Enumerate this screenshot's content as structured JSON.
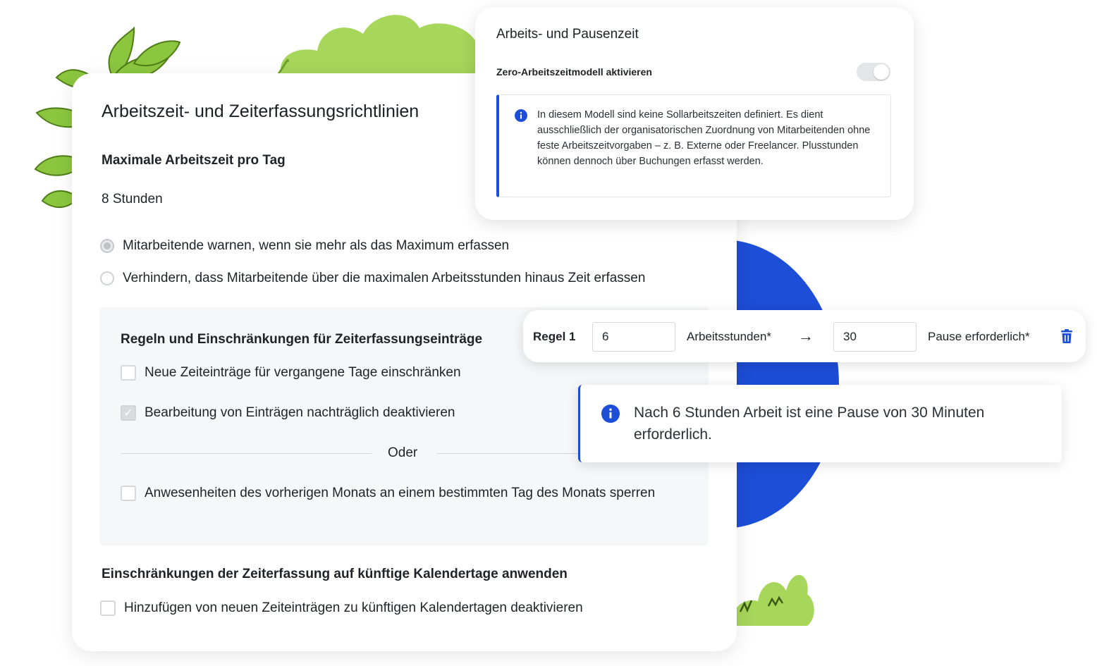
{
  "colors": {
    "accent": "#1d4ed8",
    "leaf_green": "#a6d65a",
    "dark_leaf": "#6fa32a"
  },
  "policy_card": {
    "title": "Arbeitszeit- und Zeiterfassungsrichtlinien",
    "max_label": "Maximale Arbeitszeit pro Tag",
    "max_value": "8 Stunden",
    "radio_options": [
      {
        "label": "Mitarbeitende warnen, wenn sie mehr als das Maximum erfassen",
        "selected": true
      },
      {
        "label": "Verhindern, dass Mitarbeitende über die maximalen Arbeitsstunden hinaus Zeit erfassen",
        "selected": false
      }
    ],
    "rules": {
      "title": "Regeln und Einschränkungen für Zeiterfassungseinträge",
      "checkboxes": [
        {
          "label": "Neue Zeiteinträge für vergangene Tage einschränken",
          "checked": false
        },
        {
          "label": "Bearbeitung von Einträgen nachträglich deaktivieren",
          "checked": true
        }
      ],
      "or_label": "Oder",
      "lock_checkbox": {
        "label": "Anwesenheiten des vorherigen Monats an einem bestimmten Tag des Monats sperren",
        "checked": false
      }
    },
    "future": {
      "title": "Einschränkungen der Zeiterfassung auf künftige Kalendertage anwenden",
      "checkbox": {
        "label": "Hinzufügen von neuen Zeiteinträgen zu künftigen Kalendertagen deaktivieren",
        "checked": false
      }
    }
  },
  "pause_card": {
    "title": "Arbeits- und Pausenzeit",
    "toggle_label": "Zero-Arbeitszeitmodell aktivieren",
    "toggle_on": false,
    "info_text": "In diesem Modell sind keine Sollarbeitszeiten definiert. Es dient ausschließlich der organisatorischen Zuordnung von Mitarbeitenden ohne feste Arbeitszeitvorgaben – z. B. Externe oder Freelancer. Plusstunden können dennoch über Buchungen erfasst werden."
  },
  "rule_card": {
    "label": "Regel 1",
    "hours_value": "6",
    "hours_label": "Arbeitsstunden*",
    "arrow": "→",
    "pause_value": "30",
    "pause_label": "Pause erforderlich*",
    "delete_icon": "trash-icon"
  },
  "note_card": {
    "text": "Nach 6 Stunden Arbeit ist eine Pause von 30 Minuten erforderlich."
  }
}
